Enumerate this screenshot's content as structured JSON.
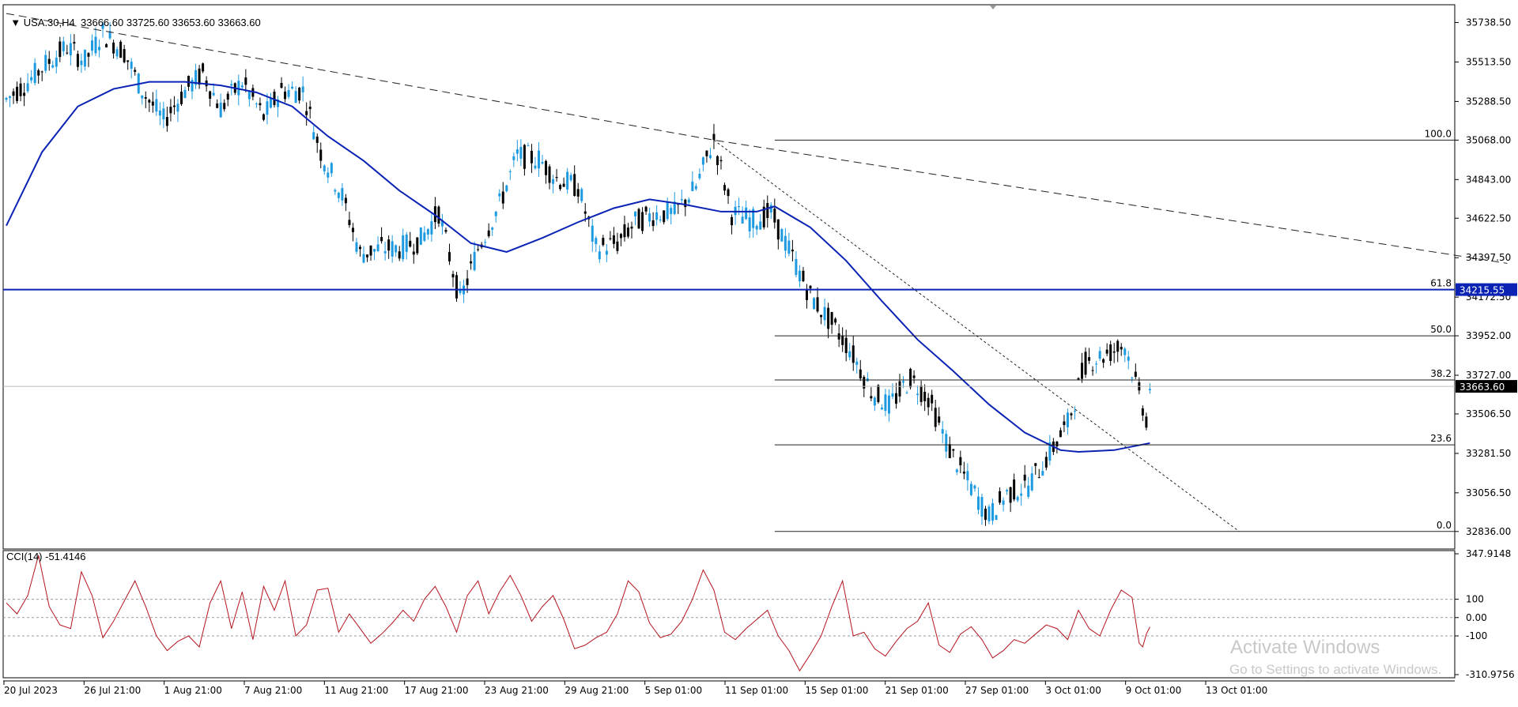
{
  "header": {
    "symbol": "USA.30,H4",
    "ohlc": "33666.60 33725.60 33653.60 33663.60"
  },
  "cci_header": "CCI(14) -51.4146",
  "watermark": {
    "line1": "Activate Windows",
    "line2": "Go to Settings to activate Windows."
  },
  "colors": {
    "bull": "#1e9be0",
    "bear": "#000000",
    "ma": "#0a23b4",
    "hline": "#0a23b4",
    "cci": "#b4141e",
    "grid": "#000000"
  },
  "chart_data": [
    {
      "type": "candlestick",
      "title": "USA.30,H4",
      "ylim": [
        32736,
        35840
      ],
      "y_ticks": [
        "35738.50",
        "35513.50",
        "35288.50",
        "35068.00",
        "34843.00",
        "34622.50",
        "34397.50",
        "34172.50",
        "33952.00",
        "33727.00",
        "33506.50",
        "33281.50",
        "33056.50",
        "32836.00"
      ],
      "x_ticks": [
        "20 Jul 2023",
        "26 Jul 21:00",
        "1 Aug 21:00",
        "7 Aug 21:00",
        "11 Aug 21:00",
        "17 Aug 21:00",
        "23 Aug 21:00",
        "29 Aug 21:00",
        "5 Sep 01:00",
        "11 Sep 01:00",
        "15 Sep 01:00",
        "21 Sep 01:00",
        "27 Sep 01:00",
        "3 Oct 01:00",
        "9 Oct 01:00",
        "13 Oct 01:00"
      ],
      "price_path": [
        {
          "bar": 0,
          "price": 35300
        },
        {
          "bar": 6,
          "price": 35400
        },
        {
          "bar": 11,
          "price": 35500
        },
        {
          "bar": 17,
          "price": 35600
        },
        {
          "bar": 22,
          "price": 35520
        },
        {
          "bar": 27,
          "price": 35680
        },
        {
          "bar": 33,
          "price": 35570
        },
        {
          "bar": 38,
          "price": 35350
        },
        {
          "bar": 44,
          "price": 35180
        },
        {
          "bar": 50,
          "price": 35350
        },
        {
          "bar": 55,
          "price": 35450
        },
        {
          "bar": 60,
          "price": 35250
        },
        {
          "bar": 66,
          "price": 35400
        },
        {
          "bar": 72,
          "price": 35200
        },
        {
          "bar": 77,
          "price": 35350
        },
        {
          "bar": 83,
          "price": 35350
        },
        {
          "bar": 88,
          "price": 35000
        },
        {
          "bar": 94,
          "price": 34750
        },
        {
          "bar": 99,
          "price": 34420
        },
        {
          "bar": 105,
          "price": 34450
        },
        {
          "bar": 110,
          "price": 34450
        },
        {
          "bar": 116,
          "price": 34500
        },
        {
          "bar": 121,
          "price": 34660
        },
        {
          "bar": 127,
          "price": 34150
        },
        {
          "bar": 132,
          "price": 34450
        },
        {
          "bar": 138,
          "price": 34700
        },
        {
          "bar": 143,
          "price": 34980
        },
        {
          "bar": 149,
          "price": 34960
        },
        {
          "bar": 154,
          "price": 34850
        },
        {
          "bar": 160,
          "price": 34800
        },
        {
          "bar": 165,
          "price": 34450
        },
        {
          "bar": 171,
          "price": 34480
        },
        {
          "bar": 176,
          "price": 34600
        },
        {
          "bar": 182,
          "price": 34650
        },
        {
          "bar": 187,
          "price": 34650
        },
        {
          "bar": 193,
          "price": 34800
        },
        {
          "bar": 198,
          "price": 35070
        },
        {
          "bar": 203,
          "price": 34650
        },
        {
          "bar": 209,
          "price": 34610
        },
        {
          "bar": 214,
          "price": 34650
        },
        {
          "bar": 220,
          "price": 34400
        },
        {
          "bar": 225,
          "price": 34180
        },
        {
          "bar": 231,
          "price": 34020
        },
        {
          "bar": 236,
          "price": 33880
        },
        {
          "bar": 242,
          "price": 33640
        },
        {
          "bar": 247,
          "price": 33550
        },
        {
          "bar": 253,
          "price": 33710
        },
        {
          "bar": 258,
          "price": 33600
        },
        {
          "bar": 264,
          "price": 33300
        },
        {
          "bar": 269,
          "price": 33120
        },
        {
          "bar": 275,
          "price": 32920
        },
        {
          "bar": 280,
          "price": 33050
        },
        {
          "bar": 286,
          "price": 33100
        },
        {
          "bar": 291,
          "price": 33250
        },
        {
          "bar": 297,
          "price": 33450
        },
        {
          "bar": 302,
          "price": 33800
        },
        {
          "bar": 308,
          "price": 33850
        },
        {
          "bar": 313,
          "price": 33900
        },
        {
          "bar": 319,
          "price": 33480
        },
        {
          "bar": 320,
          "price": 33663.6
        }
      ],
      "moving_average": [
        {
          "bar": 0,
          "price": 34580
        },
        {
          "bar": 10,
          "price": 35000
        },
        {
          "bar": 20,
          "price": 35260
        },
        {
          "bar": 30,
          "price": 35360
        },
        {
          "bar": 40,
          "price": 35400
        },
        {
          "bar": 50,
          "price": 35400
        },
        {
          "bar": 60,
          "price": 35380
        },
        {
          "bar": 70,
          "price": 35340
        },
        {
          "bar": 80,
          "price": 35260
        },
        {
          "bar": 90,
          "price": 35090
        },
        {
          "bar": 100,
          "price": 34950
        },
        {
          "bar": 110,
          "price": 34780
        },
        {
          "bar": 120,
          "price": 34640
        },
        {
          "bar": 130,
          "price": 34480
        },
        {
          "bar": 140,
          "price": 34430
        },
        {
          "bar": 150,
          "price": 34510
        },
        {
          "bar": 160,
          "price": 34600
        },
        {
          "bar": 170,
          "price": 34680
        },
        {
          "bar": 180,
          "price": 34730
        },
        {
          "bar": 190,
          "price": 34700
        },
        {
          "bar": 200,
          "price": 34660
        },
        {
          "bar": 210,
          "price": 34660
        },
        {
          "bar": 215,
          "price": 34690
        },
        {
          "bar": 225,
          "price": 34570
        },
        {
          "bar": 235,
          "price": 34380
        },
        {
          "bar": 245,
          "price": 34150
        },
        {
          "bar": 255,
          "price": 33930
        },
        {
          "bar": 265,
          "price": 33750
        },
        {
          "bar": 275,
          "price": 33560
        },
        {
          "bar": 285,
          "price": 33400
        },
        {
          "bar": 295,
          "price": 33300
        },
        {
          "bar": 300,
          "price": 33290
        },
        {
          "bar": 310,
          "price": 33300
        },
        {
          "bar": 320,
          "price": 33340
        }
      ],
      "trendline_dashed": [
        {
          "bar": 0,
          "price": 35790
        },
        {
          "bar": 198,
          "price": 35068
        },
        {
          "bar": 420,
          "price": 34365
        }
      ],
      "trendline_dotted": [
        {
          "bar": 198,
          "price": 35068
        },
        {
          "bar": 345,
          "price": 32836
        }
      ],
      "horizontal_level": {
        "price": 34215.55,
        "label": "34215.55"
      },
      "current_price": {
        "price": 33663.6,
        "label": "33663.60"
      },
      "fibonacci": {
        "start_bar": 215,
        "levels": [
          {
            "label": "100.0",
            "price": 35068
          },
          {
            "label": "61.8",
            "price": 34215.55
          },
          {
            "label": "50.0",
            "price": 33952
          },
          {
            "label": "38.2",
            "price": 33700
          },
          {
            "label": "23.6",
            "price": 33330
          },
          {
            "label": "0.0",
            "price": 32836
          }
        ]
      }
    },
    {
      "type": "line",
      "title": "CCI(14) -51.4146",
      "ylim": [
        -310.9756,
        347.9148
      ],
      "y_ticks": [
        "347.9148",
        "100",
        "0.00",
        "-100",
        "-310.9756"
      ],
      "levels": [
        100,
        0,
        -100
      ],
      "cci_path": [
        {
          "bar": 0,
          "value": 80
        },
        {
          "bar": 3,
          "value": 20
        },
        {
          "bar": 6,
          "value": 120
        },
        {
          "bar": 9,
          "value": 340
        },
        {
          "bar": 12,
          "value": 60
        },
        {
          "bar": 15,
          "value": -40
        },
        {
          "bar": 18,
          "value": -60
        },
        {
          "bar": 21,
          "value": 250
        },
        {
          "bar": 24,
          "value": 120
        },
        {
          "bar": 27,
          "value": -110
        },
        {
          "bar": 30,
          "value": -20
        },
        {
          "bar": 33,
          "value": 90
        },
        {
          "bar": 36,
          "value": 200
        },
        {
          "bar": 39,
          "value": 60
        },
        {
          "bar": 42,
          "value": -100
        },
        {
          "bar": 45,
          "value": -180
        },
        {
          "bar": 48,
          "value": -130
        },
        {
          "bar": 51,
          "value": -100
        },
        {
          "bar": 54,
          "value": -160
        },
        {
          "bar": 57,
          "value": 80
        },
        {
          "bar": 60,
          "value": 200
        },
        {
          "bar": 63,
          "value": -60
        },
        {
          "bar": 66,
          "value": 140
        },
        {
          "bar": 69,
          "value": -120
        },
        {
          "bar": 72,
          "value": 170
        },
        {
          "bar": 75,
          "value": 40
        },
        {
          "bar": 78,
          "value": 200
        },
        {
          "bar": 81,
          "value": -100
        },
        {
          "bar": 84,
          "value": -40
        },
        {
          "bar": 87,
          "value": 150
        },
        {
          "bar": 90,
          "value": 160
        },
        {
          "bar": 93,
          "value": -80
        },
        {
          "bar": 96,
          "value": 20
        },
        {
          "bar": 99,
          "value": -60
        },
        {
          "bar": 102,
          "value": -140
        },
        {
          "bar": 105,
          "value": -90
        },
        {
          "bar": 108,
          "value": -30
        },
        {
          "bar": 111,
          "value": 40
        },
        {
          "bar": 114,
          "value": -20
        },
        {
          "bar": 117,
          "value": 100
        },
        {
          "bar": 120,
          "value": 170
        },
        {
          "bar": 123,
          "value": 60
        },
        {
          "bar": 126,
          "value": -80
        },
        {
          "bar": 129,
          "value": 120
        },
        {
          "bar": 132,
          "value": 200
        },
        {
          "bar": 135,
          "value": 20
        },
        {
          "bar": 138,
          "value": 140
        },
        {
          "bar": 141,
          "value": 230
        },
        {
          "bar": 144,
          "value": 120
        },
        {
          "bar": 147,
          "value": -20
        },
        {
          "bar": 150,
          "value": 60
        },
        {
          "bar": 153,
          "value": 120
        },
        {
          "bar": 156,
          "value": -10
        },
        {
          "bar": 159,
          "value": -170
        },
        {
          "bar": 162,
          "value": -150
        },
        {
          "bar": 165,
          "value": -110
        },
        {
          "bar": 168,
          "value": -80
        },
        {
          "bar": 171,
          "value": 20
        },
        {
          "bar": 174,
          "value": 200
        },
        {
          "bar": 177,
          "value": 140
        },
        {
          "bar": 180,
          "value": -30
        },
        {
          "bar": 183,
          "value": -110
        },
        {
          "bar": 186,
          "value": -90
        },
        {
          "bar": 189,
          "value": -20
        },
        {
          "bar": 192,
          "value": 100
        },
        {
          "bar": 195,
          "value": 260
        },
        {
          "bar": 198,
          "value": 150
        },
        {
          "bar": 201,
          "value": -80
        },
        {
          "bar": 204,
          "value": -120
        },
        {
          "bar": 207,
          "value": -60
        },
        {
          "bar": 210,
          "value": -10
        },
        {
          "bar": 213,
          "value": 40
        },
        {
          "bar": 216,
          "value": -100
        },
        {
          "bar": 219,
          "value": -180
        },
        {
          "bar": 222,
          "value": -290
        },
        {
          "bar": 225,
          "value": -200
        },
        {
          "bar": 228,
          "value": -100
        },
        {
          "bar": 231,
          "value": 60
        },
        {
          "bar": 234,
          "value": 200
        },
        {
          "bar": 237,
          "value": -100
        },
        {
          "bar": 240,
          "value": -80
        },
        {
          "bar": 243,
          "value": -170
        },
        {
          "bar": 246,
          "value": -210
        },
        {
          "bar": 249,
          "value": -130
        },
        {
          "bar": 252,
          "value": -60
        },
        {
          "bar": 255,
          "value": -20
        },
        {
          "bar": 258,
          "value": 80
        },
        {
          "bar": 261,
          "value": -150
        },
        {
          "bar": 264,
          "value": -190
        },
        {
          "bar": 267,
          "value": -90
        },
        {
          "bar": 270,
          "value": -50
        },
        {
          "bar": 273,
          "value": -120
        },
        {
          "bar": 276,
          "value": -220
        },
        {
          "bar": 279,
          "value": -180
        },
        {
          "bar": 282,
          "value": -120
        },
        {
          "bar": 285,
          "value": -140
        },
        {
          "bar": 288,
          "value": -90
        },
        {
          "bar": 291,
          "value": -40
        },
        {
          "bar": 294,
          "value": -60
        },
        {
          "bar": 297,
          "value": -120
        },
        {
          "bar": 300,
          "value": 40
        },
        {
          "bar": 303,
          "value": -60
        },
        {
          "bar": 306,
          "value": -100
        },
        {
          "bar": 309,
          "value": 40
        },
        {
          "bar": 312,
          "value": 150
        },
        {
          "bar": 315,
          "value": 110
        },
        {
          "bar": 317,
          "value": -140
        },
        {
          "bar": 318,
          "value": -160
        },
        {
          "bar": 319,
          "value": -90
        },
        {
          "bar": 320,
          "value": -51.4146
        }
      ]
    }
  ]
}
